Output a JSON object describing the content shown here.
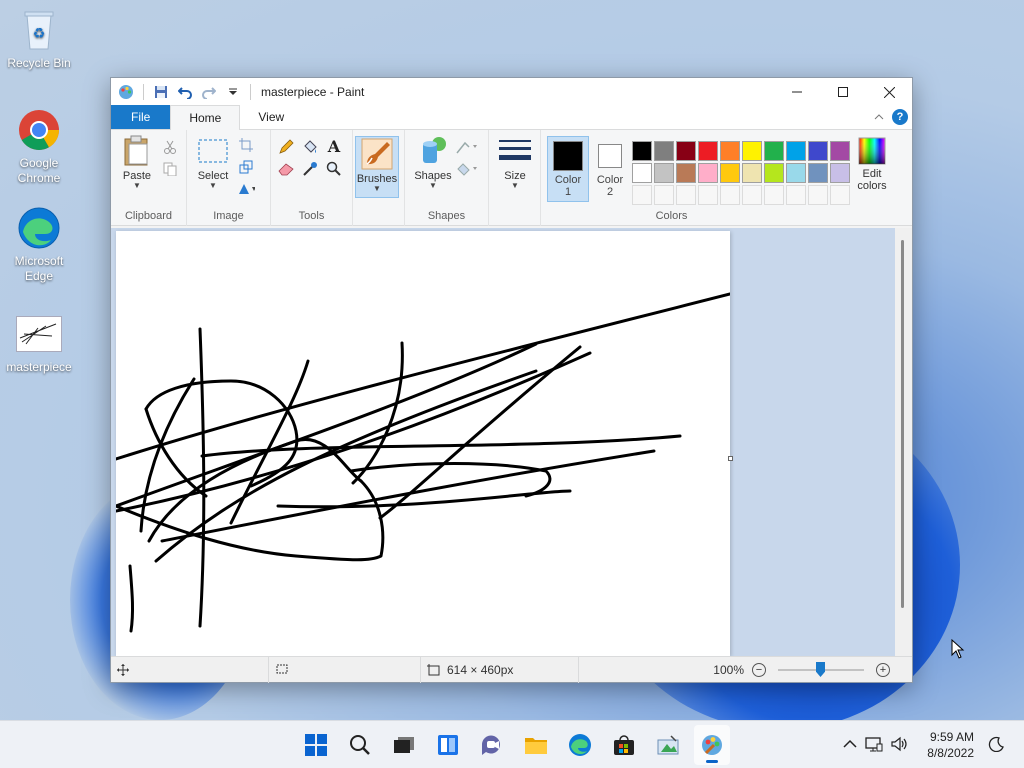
{
  "desktop": {
    "icons": [
      {
        "label": "Recycle Bin"
      },
      {
        "label": "Google Chrome"
      },
      {
        "label": "Microsoft Edge"
      },
      {
        "label": "masterpiece"
      }
    ]
  },
  "window": {
    "title": "masterpiece - Paint",
    "tabs": [
      {
        "label": "File"
      },
      {
        "label": "Home"
      },
      {
        "label": "View"
      }
    ],
    "help_label": "?"
  },
  "ribbon": {
    "clipboard": {
      "label": "Clipboard",
      "paste": "Paste"
    },
    "image": {
      "label": "Image",
      "select": "Select"
    },
    "tools": {
      "label": "Tools"
    },
    "brushes": {
      "label": "Brushes"
    },
    "shapes": {
      "label": "Shapes",
      "shapes_btn": "Shapes"
    },
    "size": {
      "label": "Size"
    },
    "colors": {
      "label": "Colors",
      "color1": {
        "label": "Color",
        "num": "1",
        "value": "#000000"
      },
      "color2": {
        "label": "Color",
        "num": "2",
        "value": "#ffffff"
      },
      "edit_colors": "Edit colors",
      "palette_row1": [
        "#000000",
        "#7f7f7f",
        "#880015",
        "#ed1c24",
        "#ff7f27",
        "#fff200",
        "#22b14c",
        "#00a2e8",
        "#3f48cc",
        "#a349a4"
      ],
      "palette_row2": [
        "#ffffff",
        "#c3c3c3",
        "#b97a57",
        "#ffaec9",
        "#ffc90e",
        "#efe4b0",
        "#b5e61d",
        "#99d9ea",
        "#7092be",
        "#c8bfe7"
      ]
    }
  },
  "status": {
    "dimensions": "614 × 460px",
    "zoom": "100%"
  },
  "taskbar": {
    "time": "9:59 AM",
    "date": "8/8/2022"
  }
}
